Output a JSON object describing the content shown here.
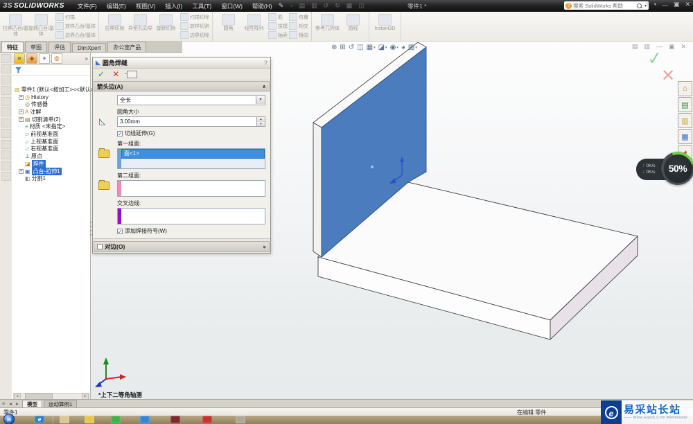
{
  "titlebar": {
    "logo_mark": "ЗS",
    "logo": "SOLIDWORKS",
    "menus": [
      "文件(F)",
      "编辑(E)",
      "视图(V)",
      "插入(I)",
      "工具(T)",
      "窗口(W)",
      "帮助(H)"
    ],
    "doc_title": "零件1 *",
    "search_placeholder": "搜索 SolidWorks 帮助",
    "help_button": "?"
  },
  "command_tabs": {
    "items": [
      "特征",
      "草图",
      "评估",
      "DimXpert",
      "办公室产品"
    ],
    "active": "特征"
  },
  "toolbar": {
    "groups": [
      {
        "big": [
          "拉伸凸台/基体",
          "旋转凸台/基体"
        ],
        "small": [
          "扫描",
          "放样凸台/基体",
          "边界凸台/基体"
        ]
      },
      {
        "big": [
          "拉伸切除",
          "异型孔向导",
          "旋转切除"
        ],
        "small": [
          "扫描切除",
          "放样切割",
          "边界切除"
        ]
      },
      {
        "big": [
          "圆角",
          "线性阵列"
        ],
        "small": [
          "筋",
          "拔模",
          "抽壳",
          "包覆",
          "相交",
          "镜向"
        ]
      },
      {
        "big": [
          "参考几何体",
          "曲线"
        ],
        "small": []
      },
      {
        "big": [
          "Instant3D"
        ],
        "small": []
      }
    ]
  },
  "feature_tree": {
    "root": "零件1 (默认<按加工><<默认>_",
    "items": [
      {
        "label": "History",
        "expand": true,
        "icon": "history-icon",
        "selected": false
      },
      {
        "label": "传感器",
        "expand": false,
        "icon": "sensors-icon",
        "selected": false
      },
      {
        "label": "注解",
        "expand": true,
        "icon": "annotations-icon",
        "selected": false
      },
      {
        "label": "切割清单(2)",
        "expand": true,
        "icon": "cut-list-icon",
        "selected": false
      },
      {
        "label": "材质 <未指定>",
        "expand": false,
        "icon": "material-icon",
        "selected": false
      },
      {
        "label": "前视基准面",
        "expand": false,
        "icon": "plane-icon",
        "selected": false
      },
      {
        "label": "上视基准面",
        "expand": false,
        "icon": "plane-icon",
        "selected": false
      },
      {
        "label": "右视基准面",
        "expand": false,
        "icon": "plane-icon",
        "selected": false
      },
      {
        "label": "原点",
        "expand": false,
        "icon": "origin-icon",
        "selected": false
      },
      {
        "label": "焊件",
        "expand": false,
        "icon": "weldment-icon",
        "selected": true
      },
      {
        "label": "凸台-拉伸1",
        "expand": true,
        "icon": "extrude-icon",
        "selected": true
      },
      {
        "label": "分割1",
        "expand": false,
        "icon": "split-icon",
        "selected": false
      }
    ]
  },
  "property_manager": {
    "title": "圆角焊缝",
    "help": "?",
    "arrow_side": {
      "header": "箭头边(A)",
      "length_type": "全长",
      "size_label": "圆角大小",
      "size_value": "3.00mm",
      "tangent_label": "切线延伸(G)",
      "group1_label": "第一组面:",
      "group1_item": "面<1>",
      "group2_label": "第二组面:",
      "intersect_label": "交叉边线:",
      "weld_symbol_label": "添加焊接符号(W)"
    },
    "other_side": {
      "header": "对边(O)"
    }
  },
  "graphics": {
    "view_label": "*上下二等角轴测",
    "headsup_icons": [
      "zoom-fit",
      "zoom-area",
      "previous-view",
      "section-view",
      "view-orientation",
      "display-style",
      "hide-show-items",
      "edit-appearance",
      "scene"
    ]
  },
  "task_pane_icons": [
    "solidworks-resources",
    "design-library",
    "file-explorer",
    "view-palette",
    "appearances",
    "custom-properties"
  ],
  "overlay_widget": {
    "up_speed": "0K/s",
    "down_speed": "0K/s",
    "percent": "50%"
  },
  "model_tabs": {
    "items": [
      "模型",
      "运动算例1"
    ],
    "active": "模型"
  },
  "status_bar": {
    "document": "零件1",
    "right": "在编辑 零件"
  },
  "watermark": {
    "logo_letter": "e",
    "name": "易采站长站",
    "tagline": "—— Www.Easck.Com Webmaster"
  },
  "colors": {
    "selection_blue": "#3d8fe0",
    "face_blue": "#4a7cbe",
    "group1_strip": "#6aa2e0",
    "group2_strip": "#f08ab8",
    "intersect_strip": "#8a10dc",
    "ok_green": "#2e9e3e",
    "cancel_red": "#d23b2f"
  }
}
